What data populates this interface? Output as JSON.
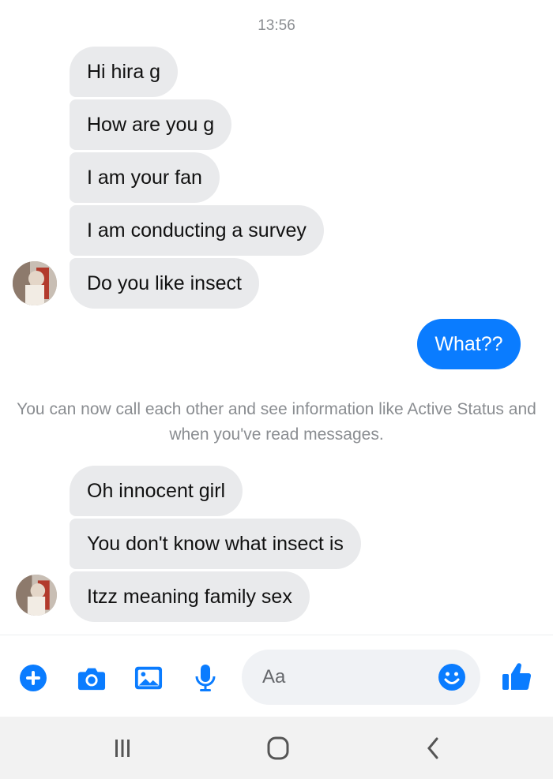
{
  "timestamp": "13:56",
  "messages_block1": [
    {
      "text": "Hi hira g"
    },
    {
      "text": "How are you g"
    },
    {
      "text": "I am your fan"
    },
    {
      "text": "I am conducting a survey"
    },
    {
      "text": "Do you like insect"
    }
  ],
  "outgoing": {
    "text": "What??"
  },
  "notice": "You can now call each other and see information like Active Status and when you've read messages.",
  "messages_block2": [
    {
      "text": "Oh innocent girl"
    },
    {
      "text": "You don't know what insect is"
    },
    {
      "text": "Itzz meaning family sex"
    }
  ],
  "composer": {
    "placeholder": "Aa",
    "icons": [
      "plus-icon",
      "camera-icon",
      "image-icon",
      "microphone-icon",
      "emoji-icon",
      "thumbs-up-icon"
    ]
  },
  "nav": {
    "icons": [
      "recent-apps-icon",
      "home-icon",
      "back-icon"
    ]
  },
  "colors": {
    "accent": "#0a7cff",
    "incoming_bubble": "#e9eaec",
    "meta_text": "#8a8d91"
  }
}
